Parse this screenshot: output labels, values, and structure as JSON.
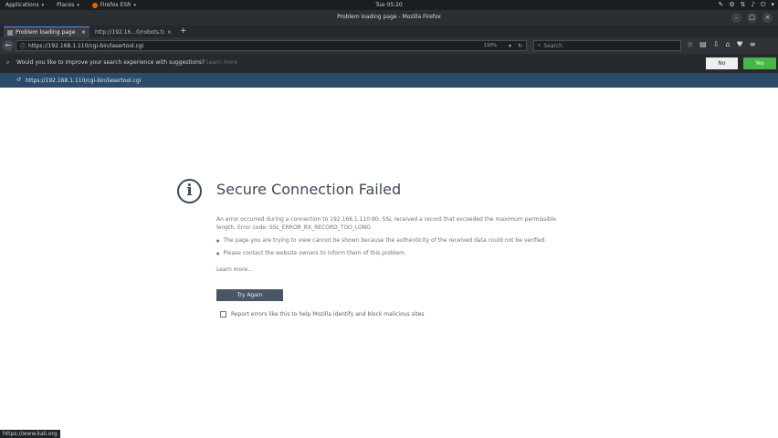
{
  "gnome_panel": {
    "applications": "Applications",
    "places": "Places",
    "active_app": "Firefox ESR",
    "clock": "Tue 05:20"
  },
  "window": {
    "title": "Problem loading page - Mozilla Firefox"
  },
  "tabs": [
    {
      "label": "Problem loading page"
    },
    {
      "label": "http://192.16...0/robots.txt"
    }
  ],
  "navbar": {
    "url": "https://192.168.1.110/cgi-bin/lasertool.cgi",
    "zoom": "110%",
    "search_placeholder": "Search"
  },
  "suggestion_bar": {
    "question": "Would you like to improve your search experience with suggestions?",
    "learn_more": "Learn more",
    "no_label": "No",
    "yes_label": "Yes"
  },
  "dropdown": {
    "url": "https://192.168.1.110/cgi-bin/lasertool.cgi"
  },
  "error": {
    "title": "Secure Connection Failed",
    "body": "An error occurred during a connection to 192.168.1.110:80. SSL received a record that exceeded the maximum permissible length. Error code: SSL_ERROR_RX_RECORD_TOO_LONG",
    "bullets": [
      "The page you are trying to view cannot be shown because the authenticity of the received data could not be verified.",
      "Please contact the website owners to inform them of this problem."
    ],
    "learn_more": "Learn more...",
    "try_again": "Try Again",
    "report": "Report errors like this to help Mozilla identify and block malicious sites"
  },
  "status": {
    "text": "https://www.kali.org"
  }
}
